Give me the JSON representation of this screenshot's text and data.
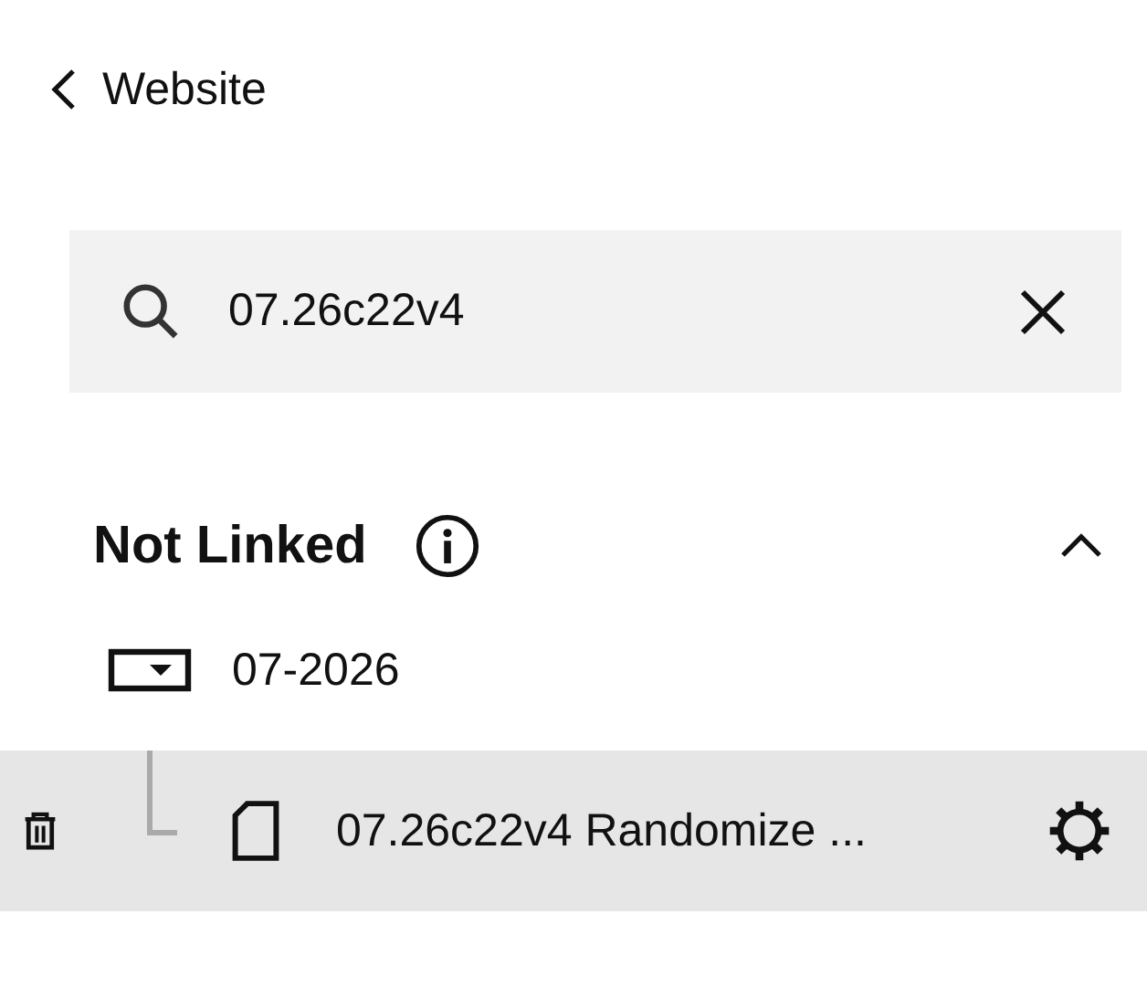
{
  "back": {
    "label": "Website"
  },
  "search": {
    "value": "07.26c22v4"
  },
  "section": {
    "title": "Not Linked",
    "expanded": true,
    "items": [
      {
        "kind": "folder",
        "label": "07-2026",
        "selected": false,
        "children": [
          {
            "kind": "page",
            "label": "07.26c22v4 Randomize ...",
            "selected": true
          }
        ]
      }
    ]
  }
}
